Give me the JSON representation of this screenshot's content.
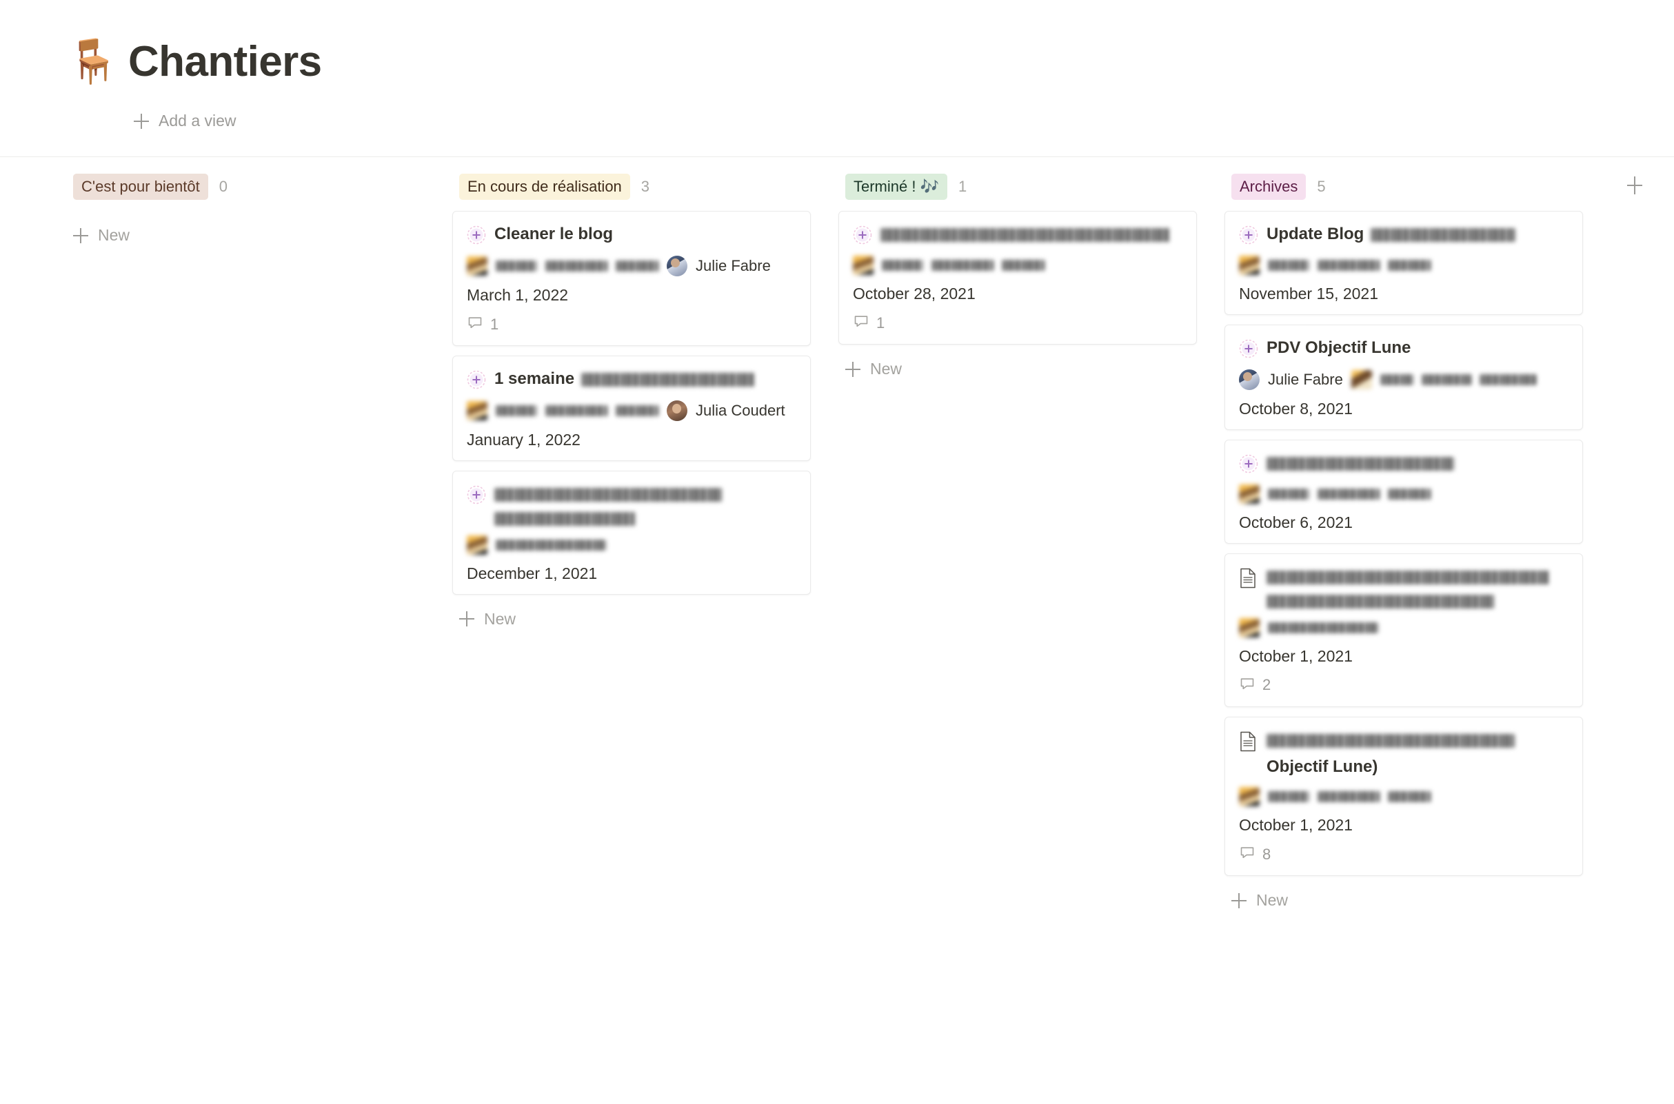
{
  "header": {
    "emoji": "🪑",
    "emoji_name": "chair-emoji",
    "title": "Chantiers",
    "add_view_label": "Add a view",
    "add_view_icon": "plus-icon"
  },
  "board": {
    "add_group_icon": "plus-icon",
    "new_label": "New",
    "columns": [
      {
        "id": "bientot",
        "label": "C'est pour bientôt",
        "count": "0",
        "chip_bg": "#eee0d9",
        "chip_color": "#5b3a29",
        "cards": []
      },
      {
        "id": "en-cours",
        "label": "En cours de réalisation",
        "count": "3",
        "chip_bg": "#fbf3db",
        "chip_color": "#402c1b",
        "cards": [
          {
            "icon": "gallery-placeholder-icon",
            "title": "Cleaner le blog",
            "title_redacted": false,
            "title_extra_redacted": false,
            "meta_emoji": true,
            "meta_redacted_widths": [
              60,
              90,
              62
            ],
            "person": "Julie Fabre",
            "person_avatar": "jf",
            "date": "March 1, 2022",
            "comments": "1"
          },
          {
            "icon": "gallery-placeholder-icon",
            "title": "1 semaine",
            "title_redacted": false,
            "title_extra_redacted": true,
            "title_redact_width": 252,
            "meta_emoji": true,
            "meta_redacted_widths": [
              60,
              90,
              62
            ],
            "person": "Julia Coudert",
            "person_avatar": "jc",
            "date": "January 1, 2022",
            "comments": ""
          },
          {
            "icon": "gallery-placeholder-icon",
            "title": "",
            "title_redacted": true,
            "title_redact_lines": [
              330,
              205
            ],
            "meta_emoji": true,
            "meta_redacted_widths": [
              160
            ],
            "person": "",
            "person_avatar": "",
            "date": "December 1, 2021",
            "comments": ""
          }
        ]
      },
      {
        "id": "termine",
        "label": "Terminé ! 🎶",
        "count": "1",
        "chip_bg": "#dbeddb",
        "chip_color": "#1c3829",
        "cards": [
          {
            "icon": "gallery-placeholder-icon",
            "title": "",
            "title_redacted": true,
            "title_redact_lines": [
              420
            ],
            "meta_emoji": true,
            "meta_redacted_widths": [
              60,
              90,
              62
            ],
            "person": "",
            "person_avatar": "",
            "date": "October 28, 2021",
            "comments": "1"
          }
        ]
      },
      {
        "id": "archives",
        "label": "Archives",
        "count": "5",
        "chip_bg": "#f6e0ef",
        "chip_color": "#5c1d46",
        "cards": [
          {
            "icon": "gallery-placeholder-icon",
            "title": "Update Blog",
            "title_redacted": false,
            "title_extra_redacted": true,
            "title_redact_width": 210,
            "meta_emoji": true,
            "meta_redacted_widths": [
              60,
              90,
              62
            ],
            "person": "",
            "person_avatar": "",
            "date": "November 15, 2021",
            "comments": ""
          },
          {
            "icon": "gallery-placeholder-icon",
            "title": "PDV Objectif Lune",
            "title_redacted": false,
            "title_extra_redacted": false,
            "meta_emoji": false,
            "person": "Julie Fabre",
            "person_avatar": "jf",
            "person_first": true,
            "meta_trailing_emoji": true,
            "meta_trailing_redacted_widths": [
              48,
              72,
              82
            ],
            "date": "October 8, 2021",
            "comments": ""
          },
          {
            "icon": "gallery-placeholder-icon",
            "title": "",
            "title_redacted": true,
            "title_redact_lines": [
              272
            ],
            "meta_emoji": true,
            "meta_redacted_widths": [
              60,
              90,
              62
            ],
            "person": "",
            "person_avatar": "",
            "date": "October 6, 2021",
            "comments": ""
          },
          {
            "icon": "page-icon",
            "title": "",
            "title_redacted": true,
            "title_redact_lines": [
              410,
              330
            ],
            "meta_emoji": true,
            "meta_redacted_widths": [
              160
            ],
            "person": "",
            "person_avatar": "",
            "date": "October 1, 2021",
            "comments": "2"
          },
          {
            "icon": "page-icon",
            "title": "Objectif Lune)",
            "title_redacted": false,
            "title_leading_redacted": true,
            "title_lead_width": 360,
            "meta_emoji": true,
            "meta_redacted_widths": [
              60,
              90,
              62
            ],
            "person": "",
            "person_avatar": "",
            "date": "October 1, 2021",
            "comments": "8"
          }
        ]
      }
    ]
  }
}
